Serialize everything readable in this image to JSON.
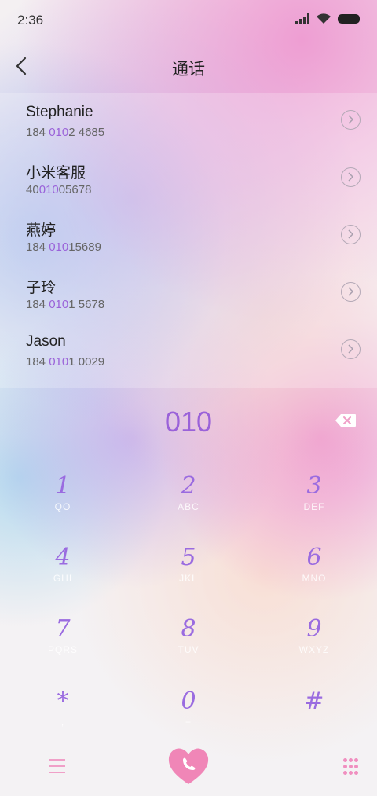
{
  "status_bar": {
    "time": "2:36"
  },
  "header": {
    "title": "通话"
  },
  "contacts": [
    {
      "name": "Stephanie",
      "number_pre": "184 ",
      "number_match": "010",
      "number_post": "2 4685"
    },
    {
      "name": "小米客服",
      "number_pre": "40",
      "number_match": "010",
      "number_post": "05678"
    },
    {
      "name": "燕婷",
      "number_pre": "184 ",
      "number_match": "010",
      "number_post": "15689"
    },
    {
      "name": "子玲",
      "number_pre": "184 ",
      "number_match": "010",
      "number_post": "1 5678"
    },
    {
      "name": "Jason",
      "number_pre": "184 ",
      "number_match": "010",
      "number_post": "1 0029"
    }
  ],
  "dialer": {
    "input": "010",
    "keys": [
      {
        "num": "1",
        "sub": "QO"
      },
      {
        "num": "2",
        "sub": "ABC"
      },
      {
        "num": "3",
        "sub": "DEF"
      },
      {
        "num": "4",
        "sub": "GHI"
      },
      {
        "num": "5",
        "sub": "JKL"
      },
      {
        "num": "6",
        "sub": "MNO"
      },
      {
        "num": "7",
        "sub": "PQRS"
      },
      {
        "num": "8",
        "sub": "TUV"
      },
      {
        "num": "9",
        "sub": "WXYZ"
      },
      {
        "num": "*",
        "sub": ","
      },
      {
        "num": "0",
        "sub": "+"
      },
      {
        "num": "#",
        "sub": ""
      }
    ]
  },
  "colors": {
    "accent": "#9a62d9",
    "pink": "#f08fc0"
  }
}
